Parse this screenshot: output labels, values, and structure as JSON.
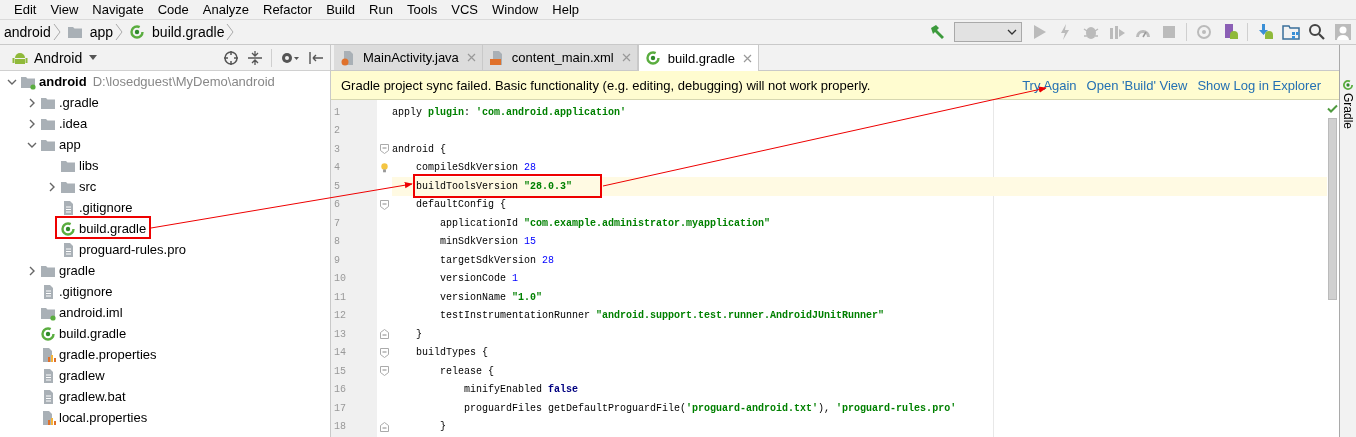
{
  "menu_bar": [
    "Edit",
    "View",
    "Navigate",
    "Code",
    "Analyze",
    "Refactor",
    "Build",
    "Run",
    "Tools",
    "VCS",
    "Window",
    "Help"
  ],
  "breadcrumbs": [
    {
      "label": "android",
      "kind": "project"
    },
    {
      "label": "app",
      "kind": "folder"
    },
    {
      "label": "build.gradle",
      "kind": "gradle"
    }
  ],
  "project_panel": {
    "view": "Android",
    "tree": [
      {
        "label": "android",
        "path": "D:\\losedguest\\MyDemo\\android",
        "kind": "module",
        "expanded": true,
        "children": [
          {
            "label": ".gradle",
            "kind": "folder",
            "expanded": false
          },
          {
            "label": ".idea",
            "kind": "folder",
            "expanded": false
          },
          {
            "label": "app",
            "kind": "folder",
            "expanded": true,
            "children": [
              {
                "label": "libs",
                "kind": "folder"
              },
              {
                "label": "src",
                "kind": "folder",
                "expanded": false
              },
              {
                "label": ".gitignore",
                "kind": "file"
              },
              {
                "label": "build.gradle",
                "kind": "gradle"
              },
              {
                "label": "proguard-rules.pro",
                "kind": "file"
              }
            ]
          },
          {
            "label": "gradle",
            "kind": "folder",
            "expanded": false
          },
          {
            "label": ".gitignore",
            "kind": "file"
          },
          {
            "label": "android.iml",
            "kind": "module"
          },
          {
            "label": "build.gradle",
            "kind": "gradle"
          },
          {
            "label": "gradle.properties",
            "kind": "properties"
          },
          {
            "label": "gradlew",
            "kind": "file"
          },
          {
            "label": "gradlew.bat",
            "kind": "file"
          },
          {
            "label": "local.properties",
            "kind": "properties"
          }
        ]
      }
    ]
  },
  "tabs": [
    {
      "label": "MainActivity.java",
      "kind": "java",
      "selected": false
    },
    {
      "label": "content_main.xml",
      "kind": "xml",
      "selected": false
    },
    {
      "label": "build.gradle",
      "kind": "gradle",
      "selected": true
    }
  ],
  "banner": {
    "message": "Gradle project sync failed. Basic functionality (e.g. editing, debugging) will not work properly.",
    "links": [
      "Try Again",
      "Open 'Build' View",
      "Show Log in Explorer"
    ]
  },
  "code": [
    {
      "number": "1",
      "current": false,
      "tokens": [
        {
          "kind": "plain",
          "text": "apply "
        },
        {
          "kind": "keyword",
          "text": "plugin"
        },
        {
          "kind": "plain",
          "text": ": "
        },
        {
          "kind": "string",
          "text": "'com.android.application'"
        }
      ]
    },
    {
      "number": "2",
      "current": false
    },
    {
      "number": "3",
      "current": false,
      "fold_start": true,
      "tokens": [
        {
          "kind": "plain",
          "text": "android {"
        }
      ]
    },
    {
      "number": "4",
      "current": false,
      "bulb": true,
      "tokens": [
        {
          "kind": "plain",
          "text": "    compileSdkVersion "
        },
        {
          "kind": "number",
          "text": "28"
        }
      ]
    },
    {
      "number": "5",
      "current": true,
      "tokens": [
        {
          "kind": "plain",
          "text": "    buildToolsVersion "
        },
        {
          "kind": "string",
          "text": "\"28.0.3\""
        }
      ]
    },
    {
      "number": "6",
      "current": false,
      "fold_start": true,
      "tokens": [
        {
          "kind": "plain",
          "text": "    defaultConfig {"
        }
      ]
    },
    {
      "number": "7",
      "current": false,
      "tokens": [
        {
          "kind": "plain",
          "text": "        applicationId "
        },
        {
          "kind": "string",
          "text": "\"com.example.administrator.myapplication\""
        }
      ]
    },
    {
      "number": "8",
      "current": false,
      "tokens": [
        {
          "kind": "plain",
          "text": "        minSdkVersion "
        },
        {
          "kind": "number",
          "text": "15"
        }
      ]
    },
    {
      "number": "9",
      "current": false,
      "tokens": [
        {
          "kind": "plain",
          "text": "        targetSdkVersion "
        },
        {
          "kind": "number",
          "text": "28"
        }
      ]
    },
    {
      "number": "10",
      "current": false,
      "tokens": [
        {
          "kind": "plain",
          "text": "        versionCode "
        },
        {
          "kind": "number",
          "text": "1"
        }
      ]
    },
    {
      "number": "11",
      "current": false,
      "tokens": [
        {
          "kind": "plain",
          "text": "        versionName "
        },
        {
          "kind": "string",
          "text": "\"1.0\""
        }
      ]
    },
    {
      "number": "12",
      "current": false,
      "tokens": [
        {
          "kind": "plain",
          "text": "        testInstrumentationRunner "
        },
        {
          "kind": "string",
          "text": "\"android.support.test.runner.AndroidJUnitRunner\""
        }
      ]
    },
    {
      "number": "13",
      "current": false,
      "fold_end": true,
      "tokens": [
        {
          "kind": "plain",
          "text": "    }"
        }
      ]
    },
    {
      "number": "14",
      "current": false,
      "fold_start": true,
      "tokens": [
        {
          "kind": "plain",
          "text": "    buildTypes {"
        }
      ]
    },
    {
      "number": "15",
      "current": false,
      "fold_start": true,
      "tokens": [
        {
          "kind": "plain",
          "text": "        release {"
        }
      ]
    },
    {
      "number": "16",
      "current": false,
      "tokens": [
        {
          "kind": "plain",
          "text": "            minifyEnabled "
        },
        {
          "kind": "literal",
          "text": "false"
        }
      ]
    },
    {
      "number": "17",
      "current": false,
      "tokens": [
        {
          "kind": "plain",
          "text": "            proguardFiles getDefaultProguardFile("
        },
        {
          "kind": "string",
          "text": "'proguard-android.txt'"
        },
        {
          "kind": "plain",
          "text": "), "
        },
        {
          "kind": "string",
          "text": "'proguard-rules.pro'"
        }
      ]
    },
    {
      "number": "18",
      "current": false,
      "fold_end": true,
      "tokens": [
        {
          "kind": "plain",
          "text": "        }"
        }
      ]
    }
  ],
  "side_panel": {
    "title": "Gradle"
  }
}
